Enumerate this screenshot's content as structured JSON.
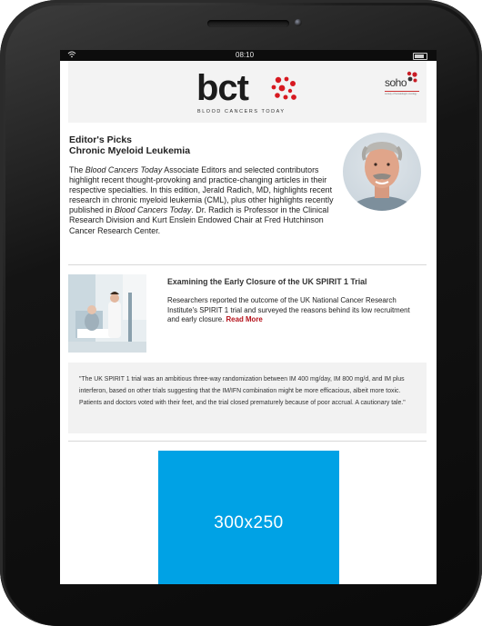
{
  "statusbar": {
    "time": "08:10",
    "wifi_icon": "wifi-icon",
    "battery_icon": "battery-icon"
  },
  "header": {
    "logo_text": "bct",
    "logo_tagline": "BLOOD CANCERS TODAY",
    "partner_logo_text": "soho",
    "partner_tagline": "society of hematologic oncology",
    "brand_color": "#d71920"
  },
  "editors_picks": {
    "heading_line1": "Editor's Picks",
    "heading_line2": "Chronic Myeloid Leukemia",
    "intro_part1": "The ",
    "intro_em1": "Blood Cancers Today",
    "intro_part2": " Associate Editors and selected contributors highlight recent thought-provoking and practice-changing articles in their respective specialties. In this edition, Jerald Radich, MD, highlights recent research in chronic myeloid leukemia (CML), plus other highlights recently published in ",
    "intro_em2": "Blood Cancers Today",
    "intro_part3": ". Dr. Radich is Professor in the Clinical Research Division and Kurt Enslein Endowed Chair at Fred Hutchinson Cancer Research Center."
  },
  "article": {
    "title": "Examining the Early Closure of the UK SPIRIT 1 Trial",
    "body": "Researchers reported the outcome of the UK National Cancer Research Institute's SPIRIT 1 trial and surveyed the reasons behind its low recruitment and early closure. ",
    "read_more": "Read More",
    "read_more_color": "#b5121b"
  },
  "quote": {
    "text": "\"The UK SPIRIT 1 trial was an ambitious three-way randomization between IM 400 mg/day, IM 800 mg/d, and IM plus interferon, based on other trials suggesting that the IM/IFN combination might be more efficacious, albeit more toxic. Patients and doctors voted with their feet, and the trial closed prematurely because of poor accrual. A cautionary tale.\""
  },
  "ad": {
    "label": "300x250",
    "color": "#00a2e5"
  }
}
